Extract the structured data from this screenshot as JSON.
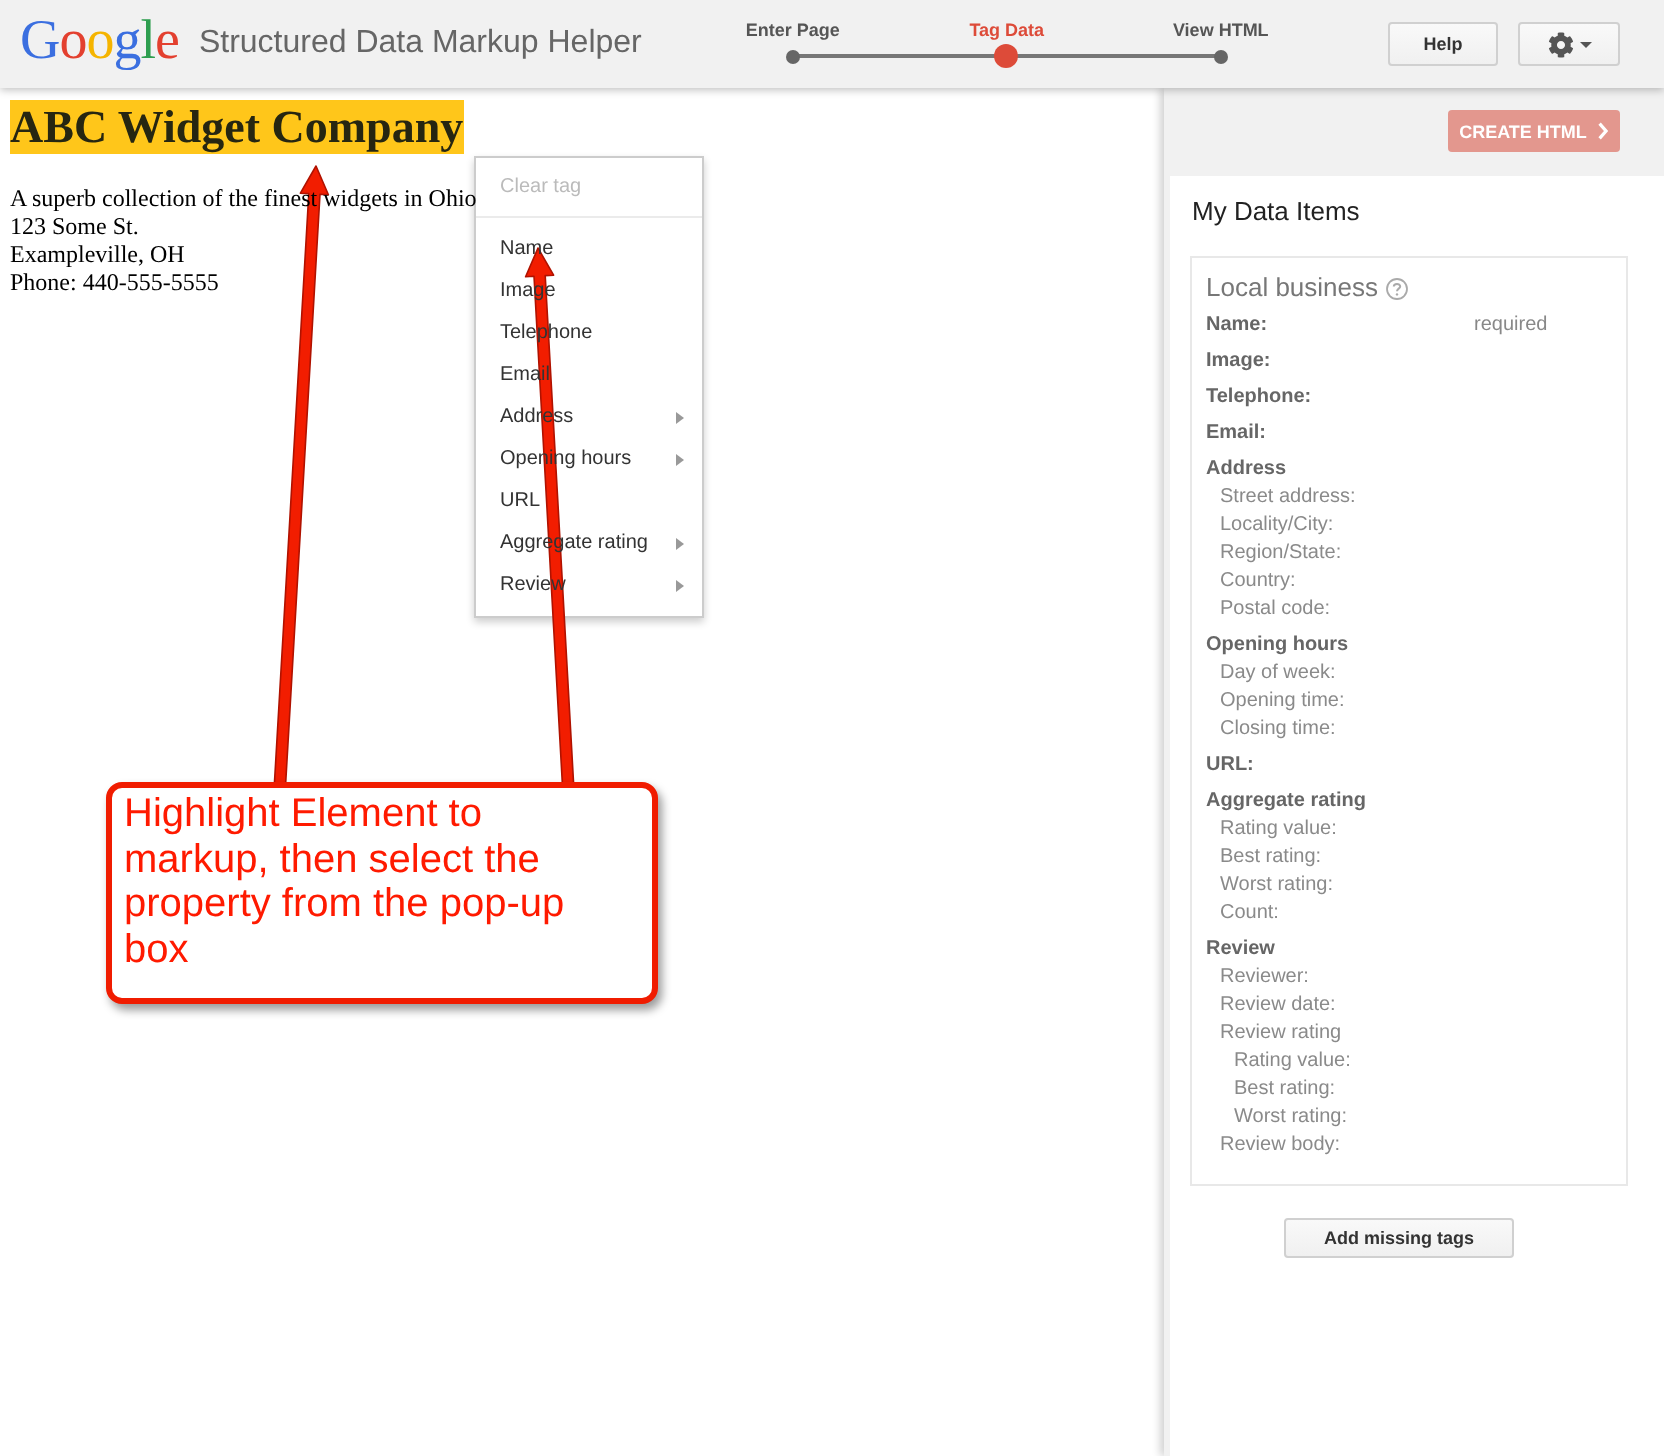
{
  "header": {
    "logo": "Google",
    "title": "Structured Data Markup Helper",
    "steps": [
      {
        "label": "Enter Page",
        "selected": false
      },
      {
        "label": "Tag Data",
        "selected": true
      },
      {
        "label": "View HTML",
        "selected": false
      }
    ],
    "help_button": "Help"
  },
  "page": {
    "heading": {
      "text": "ABC Widget Company",
      "highlighted": true
    },
    "lines": [
      "A superb collection of the finest widgets in Ohio",
      "123 Some St.",
      "Exampleville, OH",
      "Phone: 440-555-5555"
    ]
  },
  "menu": {
    "clear": {
      "label": "Clear tag",
      "disabled": true
    },
    "items": [
      {
        "label": "Name",
        "submenu": false
      },
      {
        "label": "Image",
        "submenu": false
      },
      {
        "label": "Telephone",
        "submenu": false
      },
      {
        "label": "Email",
        "submenu": false
      },
      {
        "label": "Address",
        "submenu": true
      },
      {
        "label": "Opening hours",
        "submenu": true
      },
      {
        "label": "URL",
        "submenu": false
      },
      {
        "label": "Aggregate rating",
        "submenu": true
      },
      {
        "label": "Review",
        "submenu": true
      }
    ]
  },
  "panel": {
    "create_button": {
      "label": "CREATE HTML",
      "disabled": true
    },
    "title": "My Data Items",
    "card": {
      "title": "Local business",
      "fields": [
        {
          "label": "Name:",
          "note": "required"
        },
        {
          "label": "Image:"
        },
        {
          "label": "Telephone:"
        },
        {
          "label": "Email:"
        },
        {
          "label": "Address",
          "children": [
            {
              "label": "Street address:"
            },
            {
              "label": "Locality/City:"
            },
            {
              "label": "Region/State:"
            },
            {
              "label": "Country:"
            },
            {
              "label": "Postal code:"
            }
          ]
        },
        {
          "label": "Opening hours",
          "children": [
            {
              "label": "Day of week:"
            },
            {
              "label": "Opening time:"
            },
            {
              "label": "Closing time:"
            }
          ]
        },
        {
          "label": "URL:"
        },
        {
          "label": "Aggregate rating",
          "children": [
            {
              "label": "Rating value:"
            },
            {
              "label": "Best rating:"
            },
            {
              "label": "Worst rating:"
            },
            {
              "label": "Count:"
            }
          ]
        },
        {
          "label": "Review",
          "children": [
            {
              "label": "Reviewer:"
            },
            {
              "label": "Review date:"
            },
            {
              "label": "Review rating",
              "children": [
                {
                  "label": "Rating value:"
                },
                {
                  "label": "Best rating:"
                },
                {
                  "label": "Worst rating:"
                }
              ]
            },
            {
              "label": "Review body:"
            }
          ]
        }
      ]
    },
    "add_button": "Add missing tags"
  },
  "callout": {
    "text": "Highlight Element to markup, then select the property from the pop-up box"
  }
}
